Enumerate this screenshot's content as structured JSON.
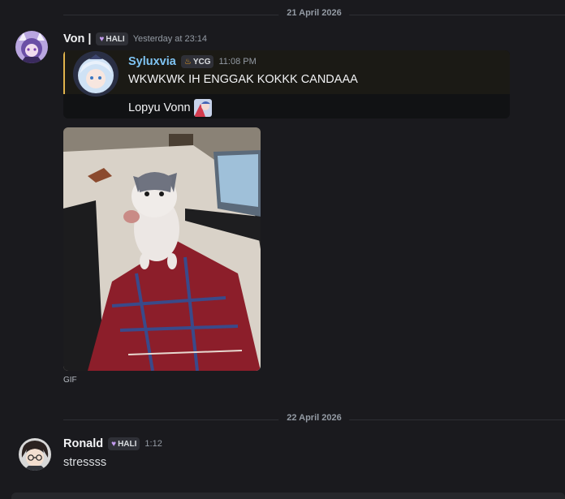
{
  "dividers": [
    "21 April 2026",
    "22 April 2026"
  ],
  "messages": [
    {
      "username": "Von |",
      "badge": "HALI",
      "timestamp": "Yesterday at 23:14",
      "reply": {
        "username": "Syluxvia",
        "badge": "YCG",
        "timestamp": "11:08 PM",
        "text": "WKWKWK IH ENGGAK KOKKK CANDAAA",
        "subtext": "Lopyu Vonn"
      },
      "attachment_label": "GIF"
    },
    {
      "username": "Ronald",
      "badge": "HALI",
      "timestamp": "1:12",
      "text": "stressss"
    }
  ],
  "colors": {
    "background": "#1a1a1e",
    "reply_accent": "#e0b34c",
    "reply_name": "#7fc4f3",
    "badge_heart": "#c39bef"
  },
  "icons": [
    "heart-icon",
    "fire-icon",
    "emoji-sticker"
  ]
}
